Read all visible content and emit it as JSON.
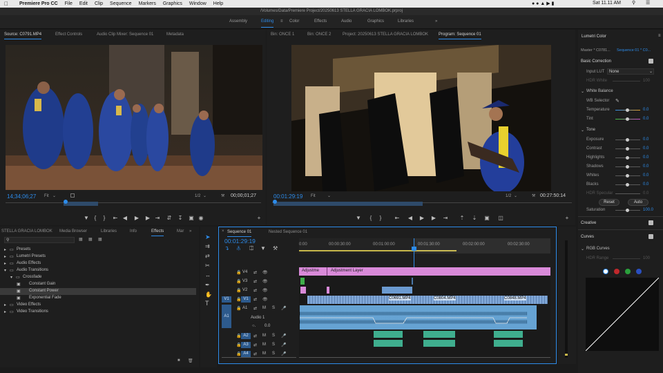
{
  "menubar": {
    "app": "Premiere Pro CC",
    "items": [
      "File",
      "Edit",
      "Clip",
      "Sequence",
      "Markers",
      "Graphics",
      "Window",
      "Help"
    ],
    "clock": "Sat 11.11 AM"
  },
  "window_title": "/Volumes/Data/Premiere Project/20250613 STELLA GRACIA LOMBOK.prproj",
  "workspaces": [
    "Assembly",
    "Editing",
    "Color",
    "Effects",
    "Audio",
    "Graphics",
    "Libraries"
  ],
  "workspace_more": "»",
  "source": {
    "tabs": [
      "Source: C0791.MP4",
      "Effect Controls",
      "Audio Clip Mixer: Sequence 01",
      "Metadata"
    ],
    "timecode": "14;34;06;27",
    "fit": "Fit",
    "ratio": "1/2",
    "duration": "00;00;01;27"
  },
  "program": {
    "tabs": [
      "Bin: ONCE 1",
      "Bin: ONCE 2",
      "Project: 20250613 STELLA GRACIA LOMBOK",
      "Program: Sequence 01"
    ],
    "timecode": "00:01:29:19",
    "fit": "Fit",
    "ratio": "1/2",
    "duration": "00:27:50:14"
  },
  "project": {
    "tabs": [
      "STELLA GRACIA LOMBOK",
      "Media Browser",
      "Libraries",
      "Info",
      "Effects",
      "Mar"
    ],
    "more": "»",
    "tree": [
      {
        "label": "Presets",
        "level": 0
      },
      {
        "label": "Lumetri Presets",
        "level": 0
      },
      {
        "label": "Audio Effects",
        "level": 0
      },
      {
        "label": "Audio Transitions",
        "level": 0
      },
      {
        "label": "Crossfade",
        "level": 1
      },
      {
        "label": "Constant Gain",
        "level": 2
      },
      {
        "label": "Constant Power",
        "level": 2
      },
      {
        "label": "Exponential Fade",
        "level": 2
      },
      {
        "label": "Video Effects",
        "level": 0
      },
      {
        "label": "Video Transitions",
        "level": 0
      }
    ]
  },
  "timeline": {
    "tabs": [
      "Sequence 01",
      "Nested Sequence 01"
    ],
    "timecode": "00:01:29:19",
    "ruler": [
      "0:00",
      "00:00:30:00",
      "00:01:00:00",
      "00:01:30:00",
      "00:02:00:00",
      "00:02:30:00"
    ],
    "tracks": [
      {
        "name": "V4",
        "label": ""
      },
      {
        "name": "V3",
        "label": ""
      },
      {
        "name": "V2",
        "label": ""
      },
      {
        "name": "V1",
        "label": "",
        "src": "V1"
      },
      {
        "name": "A1",
        "label": "Audio 1",
        "src": "A1"
      },
      {
        "name": "A2",
        "label": ""
      },
      {
        "name": "A3",
        "label": ""
      },
      {
        "name": "A4",
        "label": ""
      }
    ],
    "toggles": {
      "mute": "M",
      "solo": "S"
    },
    "clips": {
      "adj1": "Adjustme",
      "adj2": "Adjustment Layer",
      "c0691": "C0691.MP4",
      "c0804": "C0804.MP4",
      "c0848": "C0848.MP4"
    },
    "audio_value": "0.0"
  },
  "lumetri": {
    "title": "Lumetri Color",
    "master": "Master * C0781...",
    "sequence": "Sequence 01 * C0...",
    "basic": "Basic Correction",
    "input_lut_label": "Input LUT",
    "input_lut": "None",
    "hdr_white": "HDR White",
    "hdr_white_val": "100",
    "white_balance": "White Balance",
    "wb_selector": "WB Selector",
    "temperature": "Temperature",
    "temperature_val": "0.0",
    "tint": "Tint",
    "tint_val": "0.0",
    "tone": "Tone",
    "tone_rows": [
      {
        "label": "Exposure",
        "val": "0.0"
      },
      {
        "label": "Contrast",
        "val": "0.0"
      },
      {
        "label": "Highlights",
        "val": "0.0"
      },
      {
        "label": "Shadows",
        "val": "0.0"
      },
      {
        "label": "Whites",
        "val": "0.0"
      },
      {
        "label": "Blacks",
        "val": "0.0"
      },
      {
        "label": "HDR Specular",
        "val": "0.0"
      }
    ],
    "reset": "Reset",
    "auto": "Auto",
    "saturation": "Saturation",
    "saturation_val": "100.0",
    "creative": "Creative",
    "curves": "Curves",
    "rgb_curves": "RGB Curves",
    "hdr_range": "HDR Range",
    "hdr_range_val": "100"
  },
  "colors": {
    "accent": "#2d8ceb",
    "adjustment": "#d97fd9",
    "video_clip": "#7fa6d6",
    "audio_clip": "#66a3d3",
    "audio_green": "#3fae8e"
  }
}
